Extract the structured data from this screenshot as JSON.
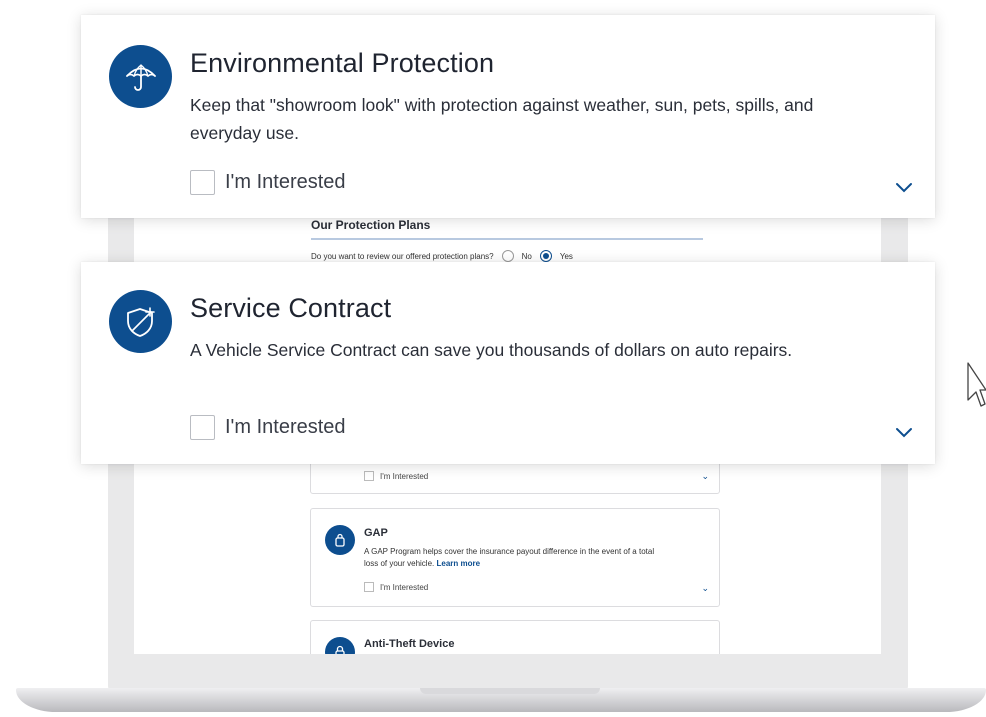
{
  "cards": [
    {
      "title": "Environmental Protection",
      "description": "Keep that \"showroom look\" with protection against weather, sun, pets, spills, and everyday use.",
      "checkbox_label": "I'm Interested",
      "icon": "umbrella-icon"
    },
    {
      "title": "Service Contract",
      "description": "A Vehicle Service Contract can save you thousands of dollars on auto repairs.",
      "checkbox_label": "I'm Interested",
      "icon": "shield-icon"
    }
  ],
  "background_page": {
    "heading": "Our Protection Plans",
    "question": "Do you want to review our offered protection plans?",
    "options": [
      "No",
      "Yes"
    ],
    "selected_option": "Yes",
    "items": [
      {
        "title": "",
        "description": "",
        "checkbox_label": "I'm Interested"
      },
      {
        "title": "GAP",
        "description": "A GAP Program helps cover the insurance payout difference in the event of a total loss of your vehicle.",
        "link": "Learn more",
        "checkbox_label": "I'm Interested",
        "icon": "lock-icon"
      },
      {
        "title": "Anti-Theft Device",
        "icon": "padlock-icon"
      }
    ]
  },
  "colors": {
    "accent": "#0d4e8f",
    "card_background": "#ffffff",
    "text": "#1f2430"
  }
}
